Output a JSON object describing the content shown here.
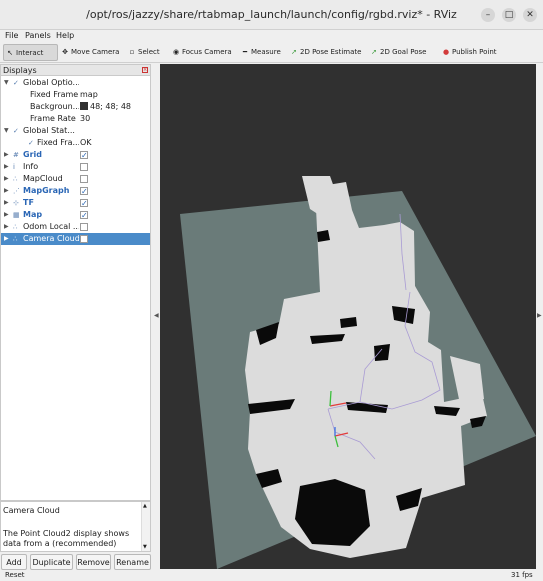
{
  "window": {
    "title": "/opt/ros/jazzy/share/rtabmap_launch/launch/config/rgbd.rviz* - RViz",
    "min_glyph": "–",
    "max_glyph": "□",
    "close_glyph": "✕"
  },
  "menu": {
    "file": "File",
    "panels": "Panels",
    "help": "Help"
  },
  "toolbar": {
    "interact": "Interact",
    "move_camera": "Move Camera",
    "select": "Select",
    "focus_camera": "Focus Camera",
    "measure": "Measure",
    "pose_estimate": "2D Pose Estimate",
    "goal_pose": "2D Goal Pose",
    "publish_point": "Publish Point"
  },
  "displays": {
    "header": "Displays",
    "rows": [
      {
        "label": "Global Optio...",
        "level": 0,
        "expanded": true
      },
      {
        "label": "Fixed Frame",
        "value": "map",
        "level": 1
      },
      {
        "label": "Backgroun...",
        "value": "48; 48; 48",
        "level": 1,
        "color": "#303030"
      },
      {
        "label": "Frame Rate",
        "value": "30",
        "level": 1
      },
      {
        "label": "Global Stat...",
        "level": 0,
        "expanded": true
      },
      {
        "label": "Fixed Fra...",
        "value": "OK",
        "level": 1
      },
      {
        "label": "Grid",
        "checked": true,
        "blue": true
      },
      {
        "label": "Info",
        "checked": false
      },
      {
        "label": "MapCloud",
        "checked": false
      },
      {
        "label": "MapGraph",
        "checked": true,
        "blue": true
      },
      {
        "label": "TF",
        "checked": true,
        "blue": true
      },
      {
        "label": "Map",
        "checked": true,
        "blue": true
      },
      {
        "label": "Odom Local ...",
        "checked": false
      },
      {
        "label": "Camera Cloud",
        "checked": false,
        "selected": true
      }
    ]
  },
  "description": {
    "title": "Camera Cloud",
    "text": "The Point Cloud2 display shows data from a (recommended)"
  },
  "buttons": {
    "add": "Add",
    "duplicate": "Duplicate",
    "remove": "Remove",
    "rename": "Rename"
  },
  "status": {
    "reset": "Reset",
    "fps": "31 fps"
  },
  "colors": {
    "background": "#303030",
    "grid_plane": "#6a7b79",
    "map_free": "#dcdcdc",
    "map_obstacle": "#050505",
    "selection": "#4a8bc9"
  }
}
